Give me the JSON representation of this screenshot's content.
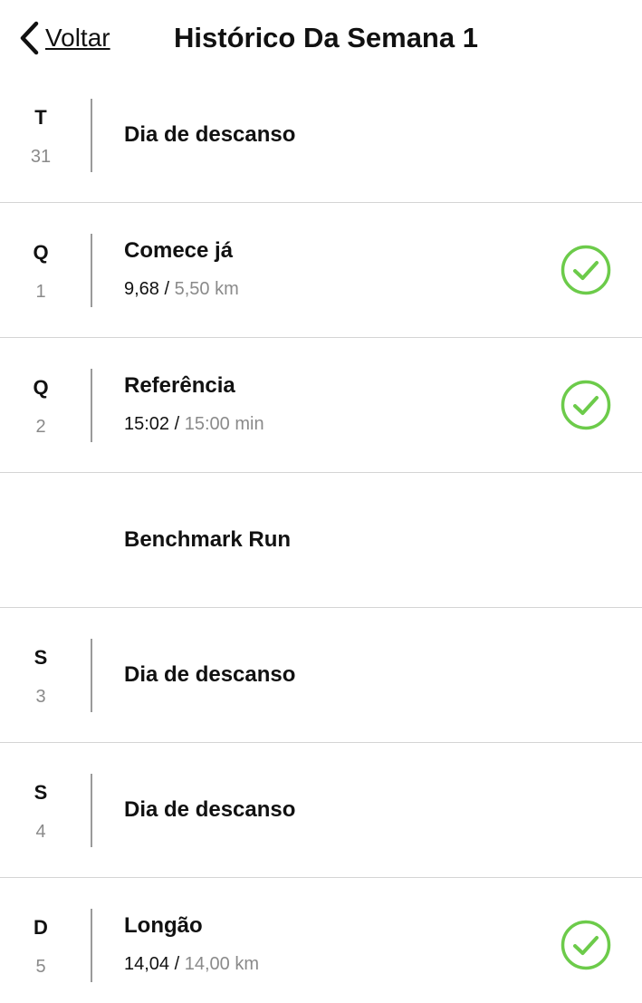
{
  "header": {
    "back_label": "Voltar",
    "title": "Histórico Da Semana 1"
  },
  "colors": {
    "accent_green": "#6ccb4a",
    "divider": "#9a9a9a",
    "muted_text": "#8a8a8a"
  },
  "days": [
    {
      "letter": "T",
      "number": "31",
      "title": "Dia de descanso"
    },
    {
      "letter": "Q",
      "number": "1",
      "title": "Comece já",
      "actual": "9,68",
      "target": "5,50 km",
      "completed": true
    },
    {
      "letter": "Q",
      "number": "2",
      "title": "Referência",
      "actual": "15:02",
      "target": "15:00 min",
      "completed": true
    },
    {
      "title": "Benchmark Run"
    },
    {
      "letter": "S",
      "number": "3",
      "title": "Dia de descanso"
    },
    {
      "letter": "S",
      "number": "4",
      "title": "Dia de descanso"
    },
    {
      "letter": "D",
      "number": "5",
      "title": "Longão",
      "actual": "14,04",
      "target": "14,00 km",
      "completed": true
    }
  ],
  "stat_separator": " / ",
  "icons": {
    "back": "chevron-left-icon",
    "completed": "check-circle-icon"
  }
}
